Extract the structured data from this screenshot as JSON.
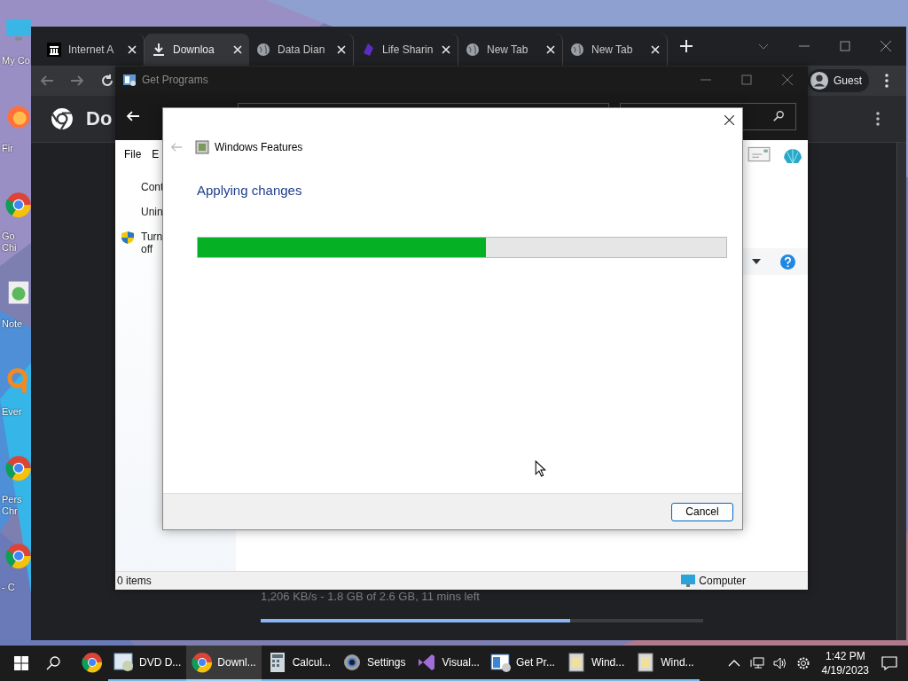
{
  "desktop_icons": [
    {
      "label": "My Co",
      "kind": "computer"
    },
    {
      "label": "Fir",
      "kind": "firefox"
    },
    {
      "label": "Go Chi",
      "kind": "chrome"
    },
    {
      "label": "Note",
      "kind": "notepad"
    },
    {
      "label": "Ever",
      "kind": "search"
    },
    {
      "label": "Pers Chr",
      "kind": "chrome"
    },
    {
      "label": "- C",
      "kind": "chrome"
    }
  ],
  "browser": {
    "tabs": [
      {
        "label": "Internet A",
        "kind": "archive",
        "selected": false
      },
      {
        "label": "Downloa",
        "kind": "download",
        "selected": true
      },
      {
        "label": "Data Dian",
        "kind": "globe",
        "selected": false
      },
      {
        "label": "Life Sharin",
        "kind": "logo",
        "selected": false
      },
      {
        "label": "New Tab",
        "kind": "globe",
        "selected": false
      },
      {
        "label": "New Tab",
        "kind": "globe",
        "selected": false
      }
    ],
    "profile": "Guest",
    "page_title": "Do",
    "download_status": "1,206 KB/s - 1.8 GB of 2.6 GB, 11 mins left",
    "download_progress": {
      "level": 0.7
    }
  },
  "explorer": {
    "title": "Get Programs",
    "menu": [
      "File",
      "E"
    ],
    "tasks": [
      {
        "label": "Cont",
        "shield": false
      },
      {
        "label": "Unin",
        "shield": false
      },
      {
        "label": "Turn off",
        "shield": true
      }
    ],
    "status_items": "0 items",
    "status_location": "Computer"
  },
  "dialog": {
    "title": "Windows Features",
    "heading": "Applying changes",
    "progress": {
      "level": 0.546
    },
    "buttons": [
      "Cancel"
    ]
  },
  "taskbar": {
    "apps": [
      {
        "kind": "chrome",
        "active": false,
        "running": false
      },
      {
        "label": "DVD D...",
        "kind": "dvd",
        "active": false,
        "running": true
      },
      {
        "label": "Downl...",
        "kind": "chrome",
        "active": true,
        "running": true
      },
      {
        "label": "Calcul...",
        "kind": "calculator",
        "active": false,
        "running": true
      },
      {
        "label": "Settings",
        "kind": "settings",
        "active": false,
        "running": true
      },
      {
        "label": "Visual...",
        "kind": "visual",
        "active": false,
        "running": true
      },
      {
        "label": "Get Pr...",
        "kind": "programs",
        "active": false,
        "running": true
      },
      {
        "label": "Wind...",
        "kind": "features",
        "active": false,
        "running": true
      },
      {
        "label": "Wind...",
        "kind": "features",
        "active": false,
        "running": true
      }
    ],
    "time": "1:42 PM",
    "date": "4/19/2023"
  }
}
